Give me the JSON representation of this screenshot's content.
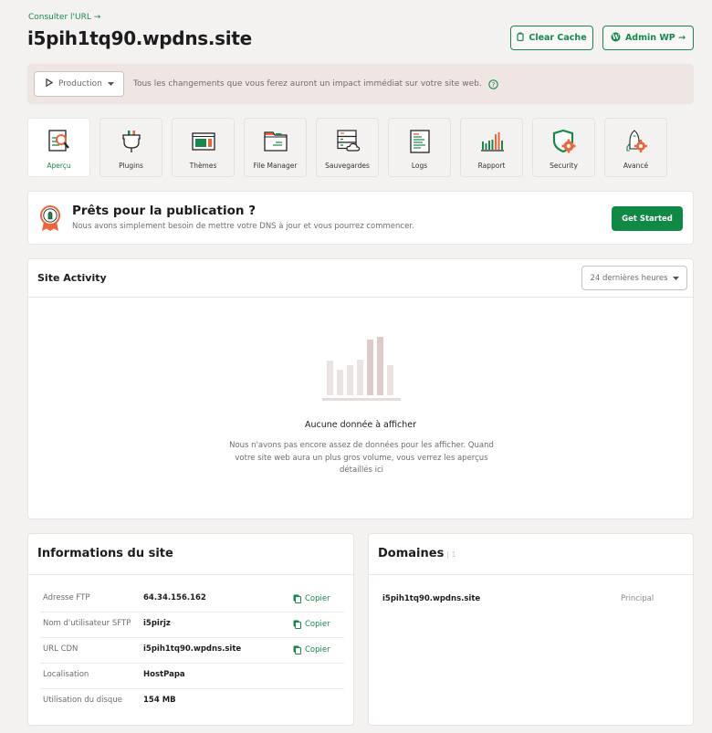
{
  "header": {
    "consult_link": "Consulter l'URL →",
    "site_title": "i5pih1tq90.wpdns.site",
    "clear_cache_label": "Clear Cache",
    "admin_wp_label": "Admin WP →"
  },
  "environment": {
    "selected": "Production",
    "message": "Tous les changements que vous ferez auront un impact immédiat sur votre site web."
  },
  "tools": [
    {
      "label": "Aperçu",
      "icon": "overview-icon",
      "active": true
    },
    {
      "label": "Plugins",
      "icon": "plug-icon"
    },
    {
      "label": "Thèmes",
      "icon": "theme-icon"
    },
    {
      "label": "File Manager",
      "icon": "folder-icon"
    },
    {
      "label": "Sauvegardes",
      "icon": "backup-icon"
    },
    {
      "label": "Logs",
      "icon": "logs-icon"
    },
    {
      "label": "Rapport",
      "icon": "report-icon"
    },
    {
      "label": "Security",
      "icon": "security-icon"
    },
    {
      "label": "Avancé",
      "icon": "advanced-icon"
    }
  ],
  "ready": {
    "title": "Prêts pour la publication ?",
    "description": "Nous avons simplement besoin de mettre votre DNS à jour et vous pourrez commencer.",
    "button_label": "Get Started"
  },
  "activity": {
    "title": "Site Activity",
    "range": "24 dernières heures",
    "empty_title": "Aucune donnée à afficher",
    "empty_description": "Nous n'avons pas encore assez de données pour les afficher. Quand votre site web aura un plus gros volume, vous verrez les aperçus détaillés ici"
  },
  "site_info": {
    "title": "Informations du site",
    "copy_label": "Copier",
    "rows": [
      {
        "key": "Adresse FTP",
        "value": "64.34.156.162",
        "copyable": true
      },
      {
        "key": "Nom d'utilisateur SFTP",
        "value": "i5pirjz",
        "copyable": true
      },
      {
        "key": "URL CDN",
        "value": "i5pih1tq90.wpdns.site",
        "copyable": true
      },
      {
        "key": "Localisation",
        "value": "HostPapa",
        "copyable": false
      },
      {
        "key": "Utilisation du disque",
        "value": "154 MB",
        "copyable": false
      }
    ]
  },
  "domains": {
    "title": "Domaines",
    "count": "| 1",
    "items": [
      {
        "domain": "i5pih1tq90.wpdns.site",
        "tag": "Principal"
      }
    ]
  },
  "colors": {
    "accent": "#17884b",
    "primary_button": "#108945",
    "orange": "#f0643c",
    "env_bar": "#efe6e4"
  }
}
